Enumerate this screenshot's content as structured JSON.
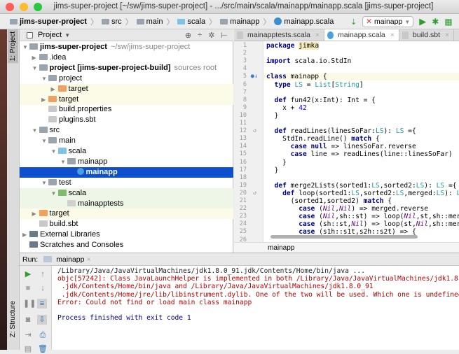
{
  "window": {
    "title": "jims-super-project [~/sw/jims-super-project] - .../src/main/scala/mainapp/mainapp.scala [jims-super-project]"
  },
  "breadcrumbs": [
    "jims-super-project",
    "src",
    "main",
    "scala",
    "mainapp",
    "mainapp.scala"
  ],
  "run_config": {
    "selected": "mainapp"
  },
  "side_tabs": {
    "project": "1: Project",
    "structure": "Z: Structure"
  },
  "project_panel": {
    "title": "Project"
  },
  "tree": [
    {
      "label": "jims-super-project",
      "extra": "~/sw/jims-super-project",
      "depth": 0,
      "arrow": "down",
      "icon": "module-folder",
      "bold": true
    },
    {
      "label": ".idea",
      "depth": 1,
      "arrow": "right",
      "icon": "folder"
    },
    {
      "label": "project [jims-super-project-build]",
      "extra": "sources root",
      "depth": 1,
      "arrow": "down",
      "icon": "sbt-folder",
      "bold": true
    },
    {
      "label": "project",
      "depth": 2,
      "arrow": "down",
      "icon": "folder"
    },
    {
      "label": "target",
      "depth": 3,
      "arrow": "right",
      "icon": "excluded-folder",
      "hl": "yel"
    },
    {
      "label": "target",
      "depth": 2,
      "arrow": "right",
      "icon": "excluded-folder",
      "hl": "yel"
    },
    {
      "label": "build.properties",
      "depth": 2,
      "arrow": "",
      "icon": "properties-file"
    },
    {
      "label": "plugins.sbt",
      "depth": 2,
      "arrow": "",
      "icon": "sbt-file"
    },
    {
      "label": "src",
      "depth": 1,
      "arrow": "down",
      "icon": "folder"
    },
    {
      "label": "main",
      "depth": 2,
      "arrow": "down",
      "icon": "folder"
    },
    {
      "label": "scala",
      "depth": 3,
      "arrow": "down",
      "icon": "source-folder"
    },
    {
      "label": "mainapp",
      "depth": 4,
      "arrow": "down",
      "icon": "package"
    },
    {
      "label": "mainapp",
      "depth": 5,
      "arrow": "",
      "icon": "scala-class",
      "hl": "sel"
    },
    {
      "label": "test",
      "depth": 2,
      "arrow": "down",
      "icon": "folder"
    },
    {
      "label": "scala",
      "depth": 3,
      "arrow": "down",
      "icon": "test-folder",
      "hl": "grn"
    },
    {
      "label": "mainapptests",
      "depth": 4,
      "arrow": "",
      "icon": "scala-file",
      "hl": "grn"
    },
    {
      "label": "target",
      "depth": 1,
      "arrow": "right",
      "icon": "excluded-folder",
      "hl": "yel"
    },
    {
      "label": "build.sbt",
      "depth": 1,
      "arrow": "",
      "icon": "sbt-file"
    },
    {
      "label": "External Libraries",
      "depth": 0,
      "arrow": "right",
      "icon": "library"
    },
    {
      "label": "Scratches and Consoles",
      "depth": 0,
      "arrow": "",
      "icon": "scratches"
    }
  ],
  "editor_tabs": [
    {
      "label": "mainapptests.scala",
      "active": false
    },
    {
      "label": "mainapp.scala",
      "active": true
    },
    {
      "label": "build.sbt",
      "active": false
    }
  ],
  "code": [
    [
      [
        "package ",
        "kw"
      ],
      [
        "jimka",
        "pk"
      ]
    ],
    [],
    [
      [
        "import ",
        "kw"
      ],
      [
        "scala.io.StdIn",
        ""
      ]
    ],
    [],
    [
      [
        "class ",
        "kw"
      ],
      [
        "mainapp {",
        ""
      ]
    ],
    [
      [
        "  type ",
        "kw"
      ],
      [
        "LS",
        "ty"
      ],
      [
        " = ",
        ""
      ],
      [
        "List",
        "ty"
      ],
      [
        "[",
        ""
      ],
      [
        "String",
        "ty"
      ],
      [
        "]",
        ""
      ]
    ],
    [],
    [
      [
        "  def ",
        "kw"
      ],
      [
        "fun42(x:Int): Int = {",
        ""
      ]
    ],
    [
      [
        "    x + ",
        ""
      ],
      [
        "42",
        "num"
      ]
    ],
    [
      [
        "  }",
        ""
      ]
    ],
    [],
    [
      [
        "  def ",
        "kw"
      ],
      [
        "readLines(linesSoFar:",
        ""
      ],
      [
        "LS",
        "ty"
      ],
      [
        "): ",
        ""
      ],
      [
        "LS",
        "ty"
      ],
      [
        " ={",
        ""
      ]
    ],
    [
      [
        "    StdIn.readLine() ",
        ""
      ],
      [
        "match ",
        "kw"
      ],
      [
        "{",
        ""
      ]
    ],
    [
      [
        "      case null ",
        "kw"
      ],
      [
        "=> linesSoFar.reverse",
        ""
      ]
    ],
    [
      [
        "      case ",
        "kw"
      ],
      [
        "line => readLines(line::linesSoFar)",
        ""
      ]
    ],
    [
      [
        "    }",
        ""
      ]
    ],
    [
      [
        "  }",
        ""
      ]
    ],
    [],
    [
      [
        "  def ",
        "kw"
      ],
      [
        "merge2Lists(sorted1:",
        ""
      ],
      [
        "LS",
        "ty"
      ],
      [
        ",sorted2:",
        ""
      ],
      [
        "LS",
        "ty"
      ],
      [
        "): ",
        ""
      ],
      [
        "LS",
        "ty"
      ],
      [
        " ={",
        ""
      ]
    ],
    [
      [
        "    def ",
        "kw"
      ],
      [
        "loop(sorted1:",
        ""
      ],
      [
        "LS",
        "ty"
      ],
      [
        ",sorted2:",
        ""
      ],
      [
        "LS",
        "ty"
      ],
      [
        ",merged:",
        ""
      ],
      [
        "LS",
        "ty"
      ],
      [
        "): ",
        ""
      ],
      [
        "LS",
        "ty"
      ],
      [
        "={",
        ""
      ]
    ],
    [
      [
        "      (sorted1,sorted2) ",
        ""
      ],
      [
        "match ",
        "kw"
      ],
      [
        "{",
        ""
      ]
    ],
    [
      [
        "        case ",
        "kw"
      ],
      [
        "(",
        ""
      ],
      [
        "Nil",
        "it"
      ],
      [
        ",",
        ""
      ],
      [
        "Nil",
        "it"
      ],
      [
        ") => merged.reverse",
        ""
      ]
    ],
    [
      [
        "        case ",
        "kw"
      ],
      [
        "(",
        ""
      ],
      [
        "Nil",
        "it"
      ],
      [
        ",sh::st) => loop(",
        ""
      ],
      [
        "Nil",
        "it"
      ],
      [
        ",st,sh::merged)",
        ""
      ]
    ],
    [
      [
        "        case ",
        "kw"
      ],
      [
        "(sh::st,",
        ""
      ],
      [
        "Nil",
        "it"
      ],
      [
        ") => loop(st,",
        ""
      ],
      [
        "Nil",
        "it"
      ],
      [
        ",sh::merged)",
        ""
      ]
    ],
    [
      [
        "        case ",
        "kw"
      ],
      [
        "(s1h::s1t,s2h::s2t) => {",
        ""
      ]
    ],
    []
  ],
  "editor_breadcrumb": "mainapp",
  "run_panel": {
    "label": "Run:",
    "tab": "mainapp"
  },
  "console": [
    {
      "text": "/Library/Java/JavaVirtualMachines/jdk1.8.0_91.jdk/Contents/Home/bin/java ...",
      "kind": "cmd"
    },
    {
      "text": "objc[57242]: Class JavaLaunchHelper is implemented in both /Library/Java/JavaVirtualMachines/jdk1.8.0_91",
      "kind": "err"
    },
    {
      "text": " .jdk/Contents/Home/bin/java and /Library/Java/JavaVirtualMachines/jdk1.8.0_91",
      "kind": "err"
    },
    {
      "text": " .jdk/Contents/Home/jre/lib/libinstrument.dylib. One of the two will be used. Which one is undefined.",
      "kind": "err"
    },
    {
      "text": "Error: Could not find or load main class mainapp",
      "kind": "err"
    },
    {
      "text": "",
      "kind": "cmd"
    },
    {
      "text": "Process finished with exit code 1",
      "kind": "ok"
    }
  ],
  "colors": {
    "selection": "#0e4fd0",
    "run_green": "#2e9e2e",
    "error_text": "#b00000",
    "excluded_folder": "#f0a060",
    "source_folder": "#7ec3e6",
    "test_folder": "#7cbc6c"
  }
}
